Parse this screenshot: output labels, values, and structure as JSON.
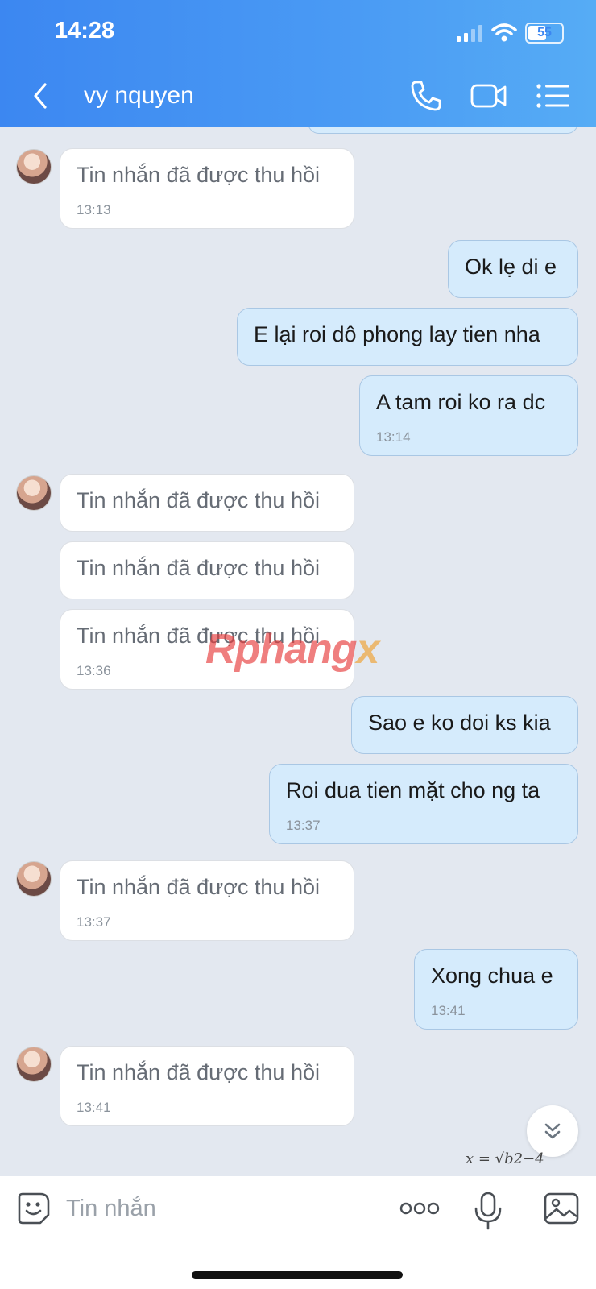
{
  "status_bar": {
    "time": "14:28",
    "battery": "55",
    "icons": [
      "cellular-signal-icon",
      "wifi-icon",
      "battery-icon"
    ]
  },
  "header": {
    "contact_name": "vy nquyen",
    "icons": [
      "back-chevron-icon",
      "phone-icon",
      "video-camera-icon",
      "list-menu-icon"
    ]
  },
  "messages": [
    {
      "dir": "in",
      "text": "Tin nhắn đã được thu hồi",
      "time": "13:13"
    },
    {
      "dir": "out",
      "text": "Ok lẹ di e",
      "time": ""
    },
    {
      "dir": "out",
      "text": "E lại roi dô phong lay tien nha",
      "time": ""
    },
    {
      "dir": "out",
      "text": "A tam roi ko ra dc",
      "time": "13:14"
    },
    {
      "dir": "in",
      "text": "Tin nhắn đã được thu hồi",
      "time": ""
    },
    {
      "dir": "in",
      "text": "Tin nhắn đã được thu hồi",
      "time": ""
    },
    {
      "dir": "in",
      "text": "Tin nhắn đã được thu hồi",
      "time": "13:36"
    },
    {
      "dir": "out",
      "text": "Sao e ko doi ks kia",
      "time": ""
    },
    {
      "dir": "out",
      "text": "Roi dua tien mặt cho ng ta",
      "time": "13:37"
    },
    {
      "dir": "in",
      "text": "Tin nhắn đã được thu hồi",
      "time": "13:37"
    },
    {
      "dir": "out",
      "text": "Xong chua e",
      "time": "13:41"
    },
    {
      "dir": "in",
      "text": "Tin nhắn đã được thu hồi",
      "time": "13:41"
    }
  ],
  "watermark": {
    "main": "Rphang",
    "accent": "x"
  },
  "overlay_formula": "x = √b2−4",
  "composer": {
    "placeholder": "Tin nhắn",
    "icons": [
      "sticker-icon",
      "more-options-icon",
      "microphone-icon",
      "image-gallery-icon"
    ]
  },
  "colors": {
    "header_start": "#3c87f1",
    "header_end": "#56acf5",
    "chat_bg": "#e3e8f0",
    "outgoing_bubble": "#d5ebfc",
    "incoming_bubble": "#ffffff"
  }
}
